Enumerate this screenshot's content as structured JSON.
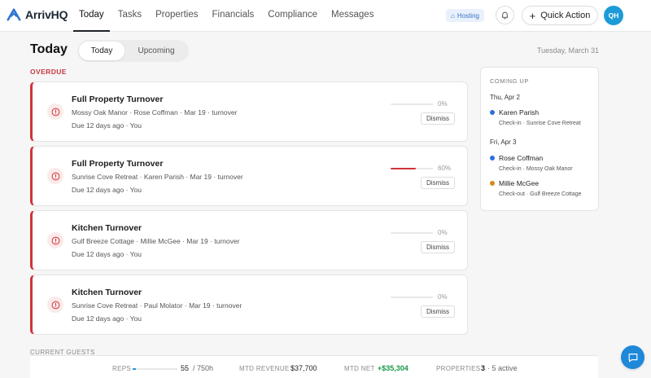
{
  "app": {
    "name": "ArrivHQ"
  },
  "nav": {
    "links": [
      {
        "label": "Today",
        "active": true
      },
      {
        "label": "Tasks",
        "active": false
      },
      {
        "label": "Properties",
        "active": false
      },
      {
        "label": "Financials",
        "active": false
      },
      {
        "label": "Compliance",
        "active": false
      },
      {
        "label": "Messages",
        "active": false
      }
    ],
    "mode_badge": "Hosting",
    "quick_action": "Quick Action",
    "avatar_initials": "QH"
  },
  "header": {
    "title": "Today",
    "tabs": [
      {
        "label": "Today",
        "active": true
      },
      {
        "label": "Upcoming",
        "active": false
      }
    ],
    "date": "Tuesday, March 31"
  },
  "overdue": {
    "label": "OVERDUE",
    "tasks": [
      {
        "title": "Full Property Turnover",
        "meta": "Mossy Oak Manor · Rose Coffman · Mar 19 · turnover",
        "due": "Due 12 days ago · You",
        "progress": "0%",
        "progress_value": 0,
        "dismiss": "Dismiss"
      },
      {
        "title": "Full Property Turnover",
        "meta": "Sunrise Cove Retreat · Karen Parish · Mar 19 · turnover",
        "due": "Due 12 days ago · You",
        "progress": "60%",
        "progress_value": 60,
        "dismiss": "Dismiss"
      },
      {
        "title": "Kitchen Turnover",
        "meta": "Gulf Breeze Cottage · Millie McGee · Mar 19 · turnover",
        "due": "Due 12 days ago · You",
        "progress": "0%",
        "progress_value": 0,
        "dismiss": "Dismiss"
      },
      {
        "title": "Kitchen Turnover",
        "meta": "Sunrise Cove Retreat · Paul Molator · Mar 19 · turnover",
        "due": "Due 12 days ago · You",
        "progress": "0%",
        "progress_value": 0,
        "dismiss": "Dismiss"
      }
    ]
  },
  "coming_up": {
    "label": "COMING UP",
    "days": [
      {
        "date": "Thu, Apr 2",
        "events": [
          {
            "guest": "Karen Parish",
            "detail": "Check-in · Sunrise Cove Retreat",
            "color": "#2f6fdc"
          }
        ]
      },
      {
        "date": "Fri, Apr 3",
        "events": [
          {
            "guest": "Rose Coffman",
            "detail": "Check-in · Mossy Oak Manor",
            "color": "#2f6fdc"
          },
          {
            "guest": "Millie McGee",
            "detail": "Check-out · Gulf Breeze Cottage",
            "color": "#d4891f"
          }
        ]
      }
    ]
  },
  "current_guests": {
    "label": "CURRENT GUESTS"
  },
  "stats": {
    "reps": {
      "label": "REPS",
      "value": "55",
      "target": "/ 750h",
      "progress_value": 7.3
    },
    "mtd_revenue": {
      "label": "MTD REVENUE",
      "value": "$37,700"
    },
    "mtd_net": {
      "label": "MTD NET",
      "value": "+$35,304",
      "color": "#1a9a4a"
    },
    "properties": {
      "label": "PROPERTIES",
      "value": "3",
      "sub": "· 5 active"
    }
  },
  "colors": {
    "accent": "#1e9bd7",
    "overdue": "#d0343a",
    "chat": "#1e88d9"
  }
}
